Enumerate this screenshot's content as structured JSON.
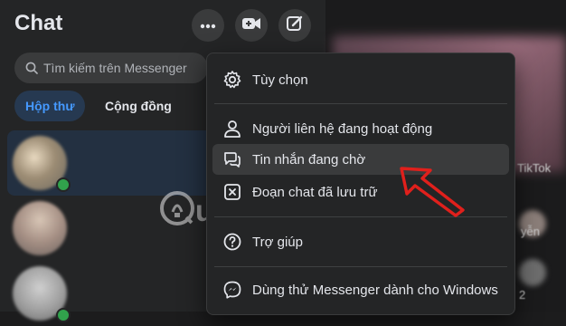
{
  "header": {
    "title": "Chat",
    "more_icon": "more-dots-icon",
    "video_icon": "video-call-icon",
    "compose_icon": "compose-icon"
  },
  "search": {
    "placeholder": "Tìm kiếm trên Messenger"
  },
  "tabs": [
    {
      "label": "Hộp thư",
      "active": true
    },
    {
      "label": "Cộng đồng",
      "active": false
    }
  ],
  "menu": {
    "items": [
      {
        "label": "Tùy chọn",
        "icon": "gear-icon"
      },
      {
        "label": "Người liên hệ đang hoạt động",
        "icon": "person-icon"
      },
      {
        "label": "Tin nhắn đang chờ",
        "icon": "chat-bubbles-icon",
        "highlighted": true
      },
      {
        "label": "Đoạn chat đã lưu trữ",
        "icon": "archive-icon"
      },
      {
        "label": "Trợ giúp",
        "icon": "help-icon"
      },
      {
        "label": "Dùng thử Messenger dành cho Windows",
        "icon": "messenger-icon"
      }
    ]
  },
  "background": {
    "tiktok_text": "TikTok",
    "text_2": "2",
    "text_n": "yễn"
  },
  "watermark": {
    "text": "uantrimang"
  },
  "colors": {
    "accent": "#4599ff",
    "annotation_arrow": "#e0201c",
    "online": "#31a24c"
  }
}
